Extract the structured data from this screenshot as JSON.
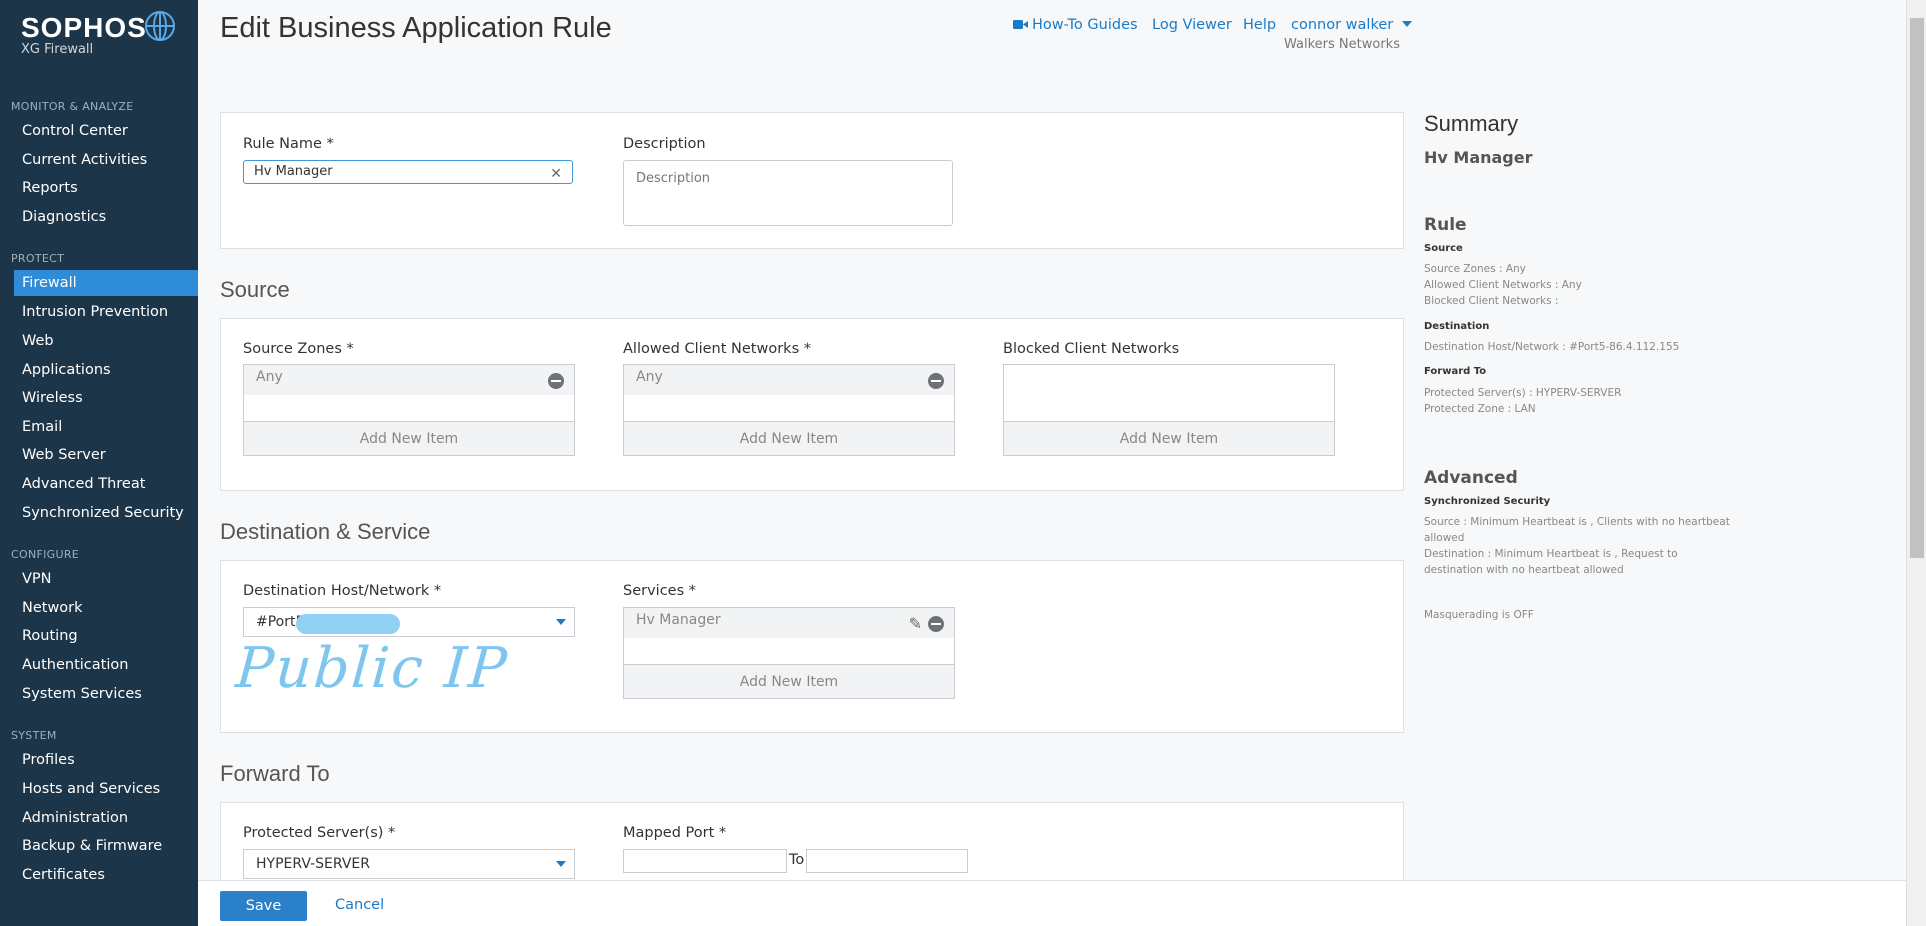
{
  "brand": {
    "name": "SOPHOS",
    "product": "XG Firewall"
  },
  "sidebar": {
    "sections": [
      {
        "title": "MONITOR & ANALYZE",
        "items": [
          "Control Center",
          "Current Activities",
          "Reports",
          "Diagnostics"
        ]
      },
      {
        "title": "PROTECT",
        "items": [
          "Firewall",
          "Intrusion Prevention",
          "Web",
          "Applications",
          "Wireless",
          "Email",
          "Web Server",
          "Advanced Threat",
          "Synchronized Security"
        ]
      },
      {
        "title": "CONFIGURE",
        "items": [
          "VPN",
          "Network",
          "Routing",
          "Authentication",
          "System Services"
        ]
      },
      {
        "title": "SYSTEM",
        "items": [
          "Profiles",
          "Hosts and Services",
          "Administration",
          "Backup & Firmware",
          "Certificates"
        ]
      }
    ],
    "active": "Firewall"
  },
  "header": {
    "title": "Edit Business Application Rule",
    "how_to": "How-To Guides",
    "log_viewer": "Log Viewer",
    "help": "Help",
    "user": "connor walker",
    "org": "Walkers Networks"
  },
  "rule": {
    "name_label": "Rule Name *",
    "name_value": "Hv Manager",
    "desc_label": "Description",
    "desc_placeholder": "Description"
  },
  "source": {
    "title": "Source",
    "zones_label": "Source Zones *",
    "zones_value": "Any",
    "allowed_label": "Allowed Client Networks *",
    "allowed_value": "Any",
    "blocked_label": "Blocked Client Networks",
    "add_new": "Add New Item"
  },
  "destination": {
    "title": "Destination & Service",
    "host_label": "Destination Host/Network *",
    "host_value": "#Port5",
    "services_label": "Services *",
    "services_value": "Hv Manager",
    "annotation": "Public IP"
  },
  "forward": {
    "title": "Forward To",
    "servers_label": "Protected Server(s) *",
    "servers_value": "HYPERV-SERVER",
    "port_label": "Mapped Port *",
    "to": "To"
  },
  "summary": {
    "title": "Summary",
    "name": "Hv Manager",
    "rule_title": "Rule",
    "source_h": "Source",
    "source_lines": [
      "Source Zones : Any",
      "Allowed Client Networks : Any",
      "Blocked Client Networks :"
    ],
    "dest_h": "Destination",
    "dest_line": "Destination Host/Network : #Port5-86.4.112.155",
    "fwd_h": "Forward To",
    "fwd_lines": [
      "Protected Server(s) : HYPERV-SERVER",
      "Protected Zone : LAN"
    ],
    "adv_title": "Advanced",
    "sync_h": "Synchronized Security",
    "sync_lines": [
      "Source : Minimum Heartbeat is , Clients with no heartbeat allowed",
      "Destination : Minimum Heartbeat is , Request to destination with no heartbeat allowed"
    ],
    "masq": "Masquerading is OFF"
  },
  "footer": {
    "save": "Save",
    "cancel": "Cancel"
  }
}
